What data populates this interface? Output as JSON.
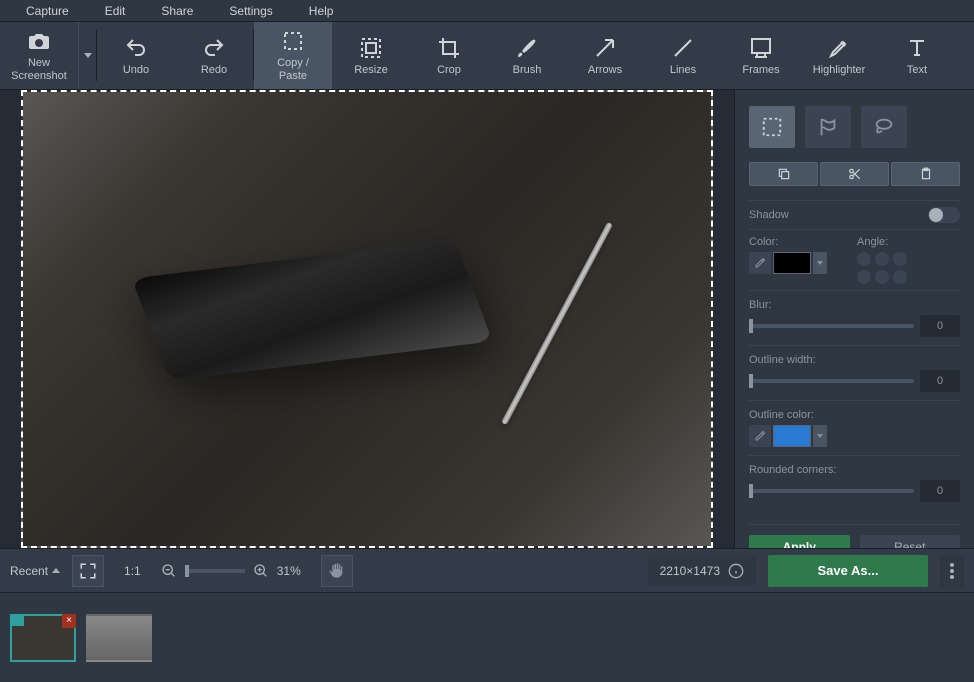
{
  "menubar": [
    "Capture",
    "Edit",
    "Share",
    "Settings",
    "Help"
  ],
  "toolbar": {
    "new_screenshot": "New\nScreenshot",
    "undo": "Undo",
    "redo": "Redo",
    "copy_paste": "Copy /\nPaste",
    "resize": "Resize",
    "crop": "Crop",
    "brush": "Brush",
    "arrows": "Arrows",
    "lines": "Lines",
    "frames": "Frames",
    "highlighter": "Highlighter",
    "text": "Text"
  },
  "side": {
    "shadow_label": "Shadow",
    "color_label": "Color:",
    "angle_label": "Angle:",
    "blur_label": "Blur:",
    "blur_value": "0",
    "outline_width_label": "Outline width:",
    "outline_width_value": "0",
    "outline_color_label": "Outline color:",
    "rounded_label": "Rounded corners:",
    "rounded_value": "0",
    "apply": "Apply",
    "reset": "Reset",
    "shadow_color": "#000000",
    "outline_color": "#2a7ad4"
  },
  "status": {
    "recent": "Recent",
    "one_to_one": "1:1",
    "zoom_pct": "31%",
    "dimensions": "2210×1473",
    "save_as": "Save As..."
  }
}
